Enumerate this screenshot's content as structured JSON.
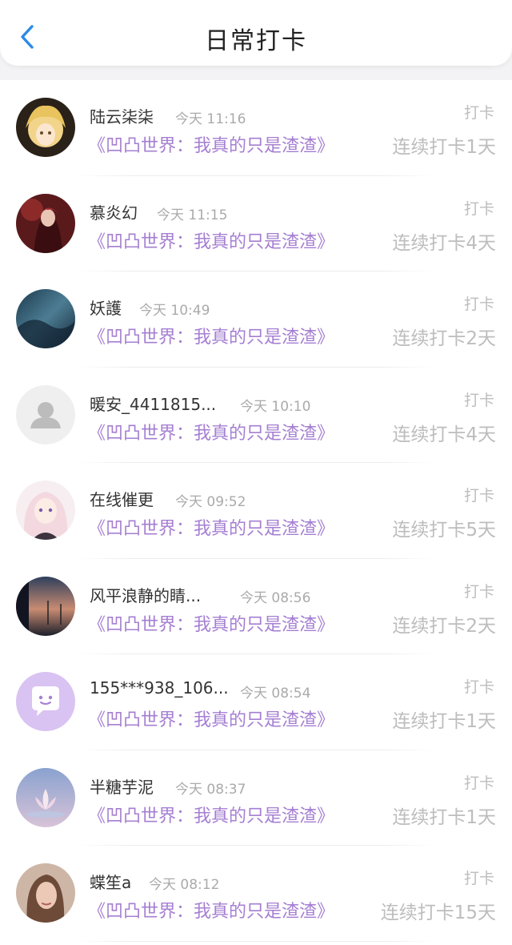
{
  "header": {
    "title": "日常打卡",
    "back_icon": "chevron-left-icon",
    "accent": "#2b8be6"
  },
  "colors": {
    "book_title": "#a57fd2",
    "muted": "#bdbdbd"
  },
  "records": [
    {
      "name": "陆云柒柒",
      "time": "今天 11:16",
      "book": "《凹凸世界：我真的只是渣渣》",
      "tag": "打卡",
      "streak": "连续打卡1天",
      "avatar": "anime-blonde-avatar"
    },
    {
      "name": "慕炎幻",
      "time": "今天 11:15",
      "book": "《凹凸世界：我真的只是渣渣》",
      "tag": "打卡",
      "streak": "连续打卡4天",
      "avatar": "anime-red-avatar"
    },
    {
      "name": "妖護",
      "time": "今天 10:49",
      "book": "《凹凸世界：我真的只是渣渣》",
      "tag": "打卡",
      "streak": "连续打卡2天",
      "avatar": "night-sky-avatar"
    },
    {
      "name": "暖安_4411815...",
      "time": "今天 10:10",
      "book": "《凹凸世界：我真的只是渣渣》",
      "tag": "打卡",
      "streak": "连续打卡4天",
      "avatar": "default-user-avatar"
    },
    {
      "name": "在线催更",
      "time": "今天 09:52",
      "book": "《凹凸世界：我真的只是渣渣》",
      "tag": "打卡",
      "streak": "连续打卡5天",
      "avatar": "anime-pink-hair-avatar"
    },
    {
      "name": "风平浪静的睛...",
      "time": "今天 08:56",
      "book": "《凹凸世界：我真的只是渣渣》",
      "tag": "打卡",
      "streak": "连续打卡2天",
      "avatar": "sunset-photo-avatar"
    },
    {
      "name": "155***938_106...",
      "time": "今天 08:54",
      "book": "《凹凸世界：我真的只是渣渣》",
      "tag": "打卡",
      "streak": "连续打卡1天",
      "avatar": "chat-bubble-avatar"
    },
    {
      "name": "半糖芋泥",
      "time": "今天 08:37",
      "book": "《凹凸世界：我真的只是渣渣》",
      "tag": "打卡",
      "streak": "连续打卡1天",
      "avatar": "lotus-flower-avatar"
    },
    {
      "name": "蝶笙a",
      "time": "今天 08:12",
      "book": "《凹凸世界：我真的只是渣渣》",
      "tag": "打卡",
      "streak": "连续打卡15天",
      "avatar": "portrait-photo-avatar"
    }
  ]
}
